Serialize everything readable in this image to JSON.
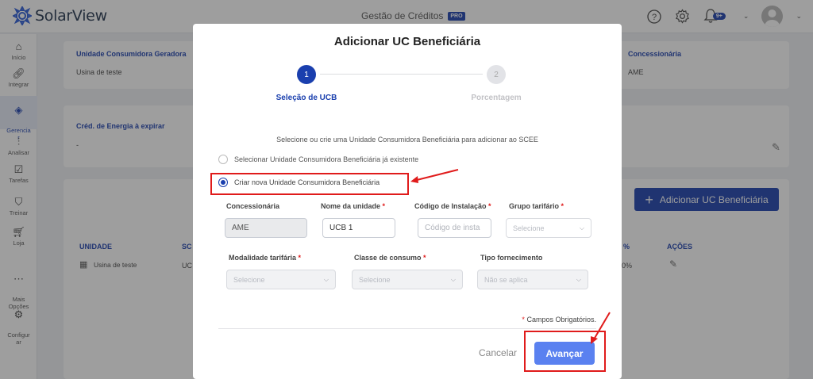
{
  "app": {
    "name": "SolarView",
    "section": "Gestão de Créditos",
    "badge": "PRO",
    "notifications": "9+"
  },
  "sidebar": {
    "items": [
      {
        "label": "Início",
        "icon": "home-icon"
      },
      {
        "label": "Integrar",
        "icon": "link-icon"
      },
      {
        "label": "Gerencia\nr",
        "icon": "layers-icon",
        "active": true
      },
      {
        "label": "Analisar",
        "icon": "chart-icon"
      },
      {
        "label": "Tarefas",
        "icon": "checkbox-icon"
      },
      {
        "label": "Treinar",
        "icon": "graduation-icon"
      },
      {
        "label": "Loja",
        "icon": "cart-icon"
      },
      {
        "label": "Mais\nOpções",
        "icon": "more-icon"
      },
      {
        "label": "Configur\nar",
        "icon": "gear-icon"
      }
    ]
  },
  "background": {
    "generator_label": "Unidade Consumidora Geradora",
    "generator_value": "Usina de teste",
    "utility_label": "Concessionária",
    "utility_value": "AME",
    "credits_label": "Créd. de Energia à expirar",
    "credits_value": "-",
    "add_button": "Adicionar UC Beneficiária",
    "table": {
      "col_unit": "UNIDADE",
      "col_partial": "SC",
      "col_pct": "%",
      "col_actions": "AÇÕES",
      "row_unit": "Usina de teste",
      "row_partial": "UC",
      "row_pct": "0%"
    }
  },
  "modal": {
    "title": "Adicionar UC Beneficiária",
    "steps": [
      {
        "number": "1",
        "label": "Seleção de UCB"
      },
      {
        "number": "2",
        "label": "Porcentagem"
      }
    ],
    "instruction": "Selecione ou crie uma Unidade Consumidora Beneficiária para adicionar ao SCEE",
    "option_existing": "Selecionar Unidade Consumidora Beneficiária já existente",
    "option_new": "Criar nova Unidade Consumidora Beneficiária",
    "fields": {
      "utility": {
        "label": "Concessionária",
        "value": "AME"
      },
      "unit_name": {
        "label": "Nome da unidade",
        "value": "UCB 1"
      },
      "install_code": {
        "label": "Código de Instalação",
        "placeholder": "Código de insta"
      },
      "tariff_group": {
        "label": "Grupo tarifário",
        "value": "Selecione"
      },
      "tariff_mode": {
        "label": "Modalidade tarifária",
        "value": "Selecione"
      },
      "consumer_class": {
        "label": "Classe de consumo",
        "value": "Selecione"
      },
      "supply_type": {
        "label": "Tipo fornecimento",
        "value": "Não se aplica"
      }
    },
    "required_asterisk": "*",
    "required_note": "Campos Obrigatórios.",
    "cancel": "Cancelar",
    "next": "Avançar"
  },
  "colors": {
    "brand": "#1a3fae",
    "primary_button": "#5a81f0",
    "highlight": "#e01b1b"
  }
}
